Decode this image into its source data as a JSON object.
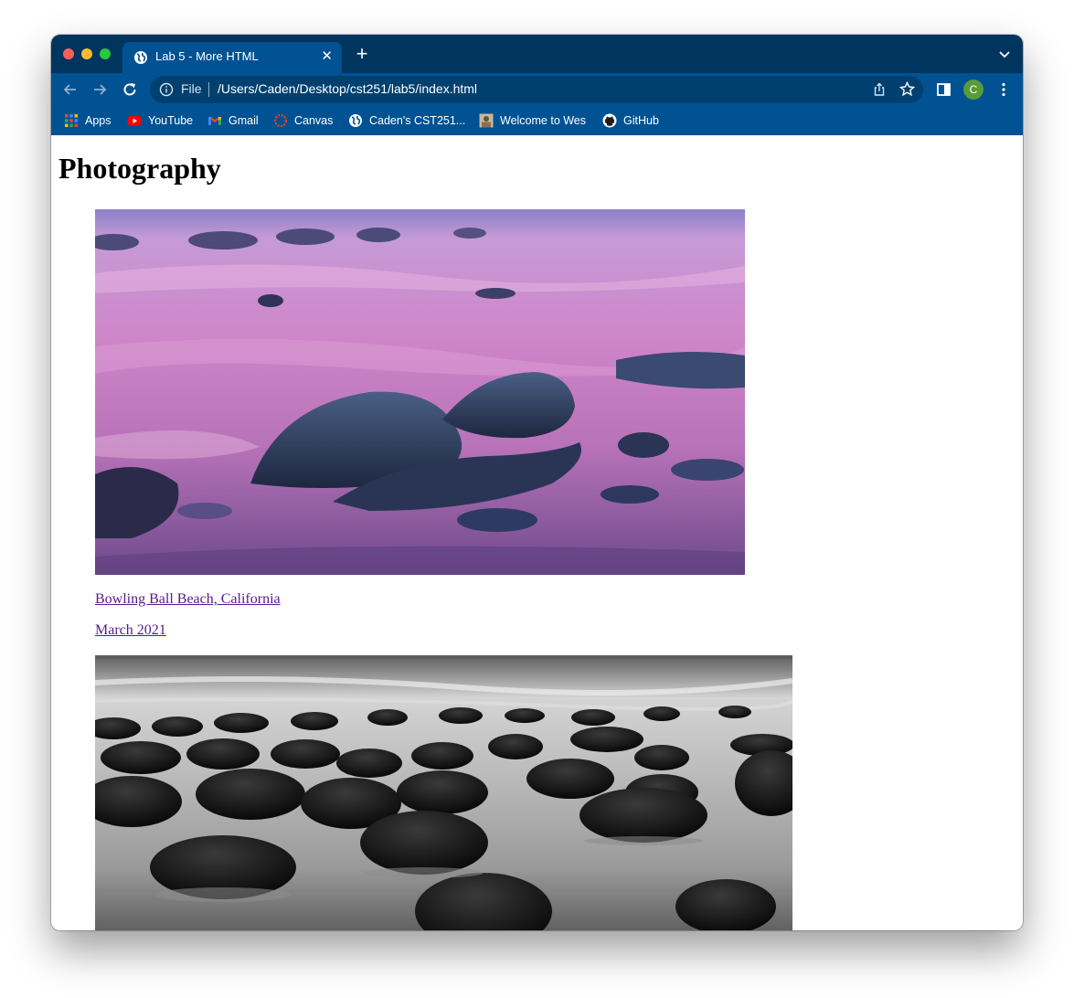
{
  "browser": {
    "tab_title": "Lab 5 - More HTML",
    "address_scheme": "File",
    "address_url": "/Users/Caden/Desktop/cst251/lab5/index.html",
    "profile_initial": "C",
    "theme_color": "#005293"
  },
  "bookmarks": [
    {
      "label": "Apps",
      "icon": "apps-grid-icon"
    },
    {
      "label": "YouTube",
      "icon": "youtube-icon"
    },
    {
      "label": "Gmail",
      "icon": "gmail-icon"
    },
    {
      "label": "Canvas",
      "icon": "canvas-icon"
    },
    {
      "label": "Caden's CST251...",
      "icon": "globe-icon"
    },
    {
      "label": "Welcome to Wes",
      "icon": "favicon-image-icon"
    },
    {
      "label": "GitHub",
      "icon": "github-icon"
    }
  ],
  "page": {
    "heading": "Photography",
    "photos": [
      {
        "caption": "Bowling Ball Beach, California",
        "date": "March 2021"
      }
    ],
    "link_color": "#551a8b"
  }
}
